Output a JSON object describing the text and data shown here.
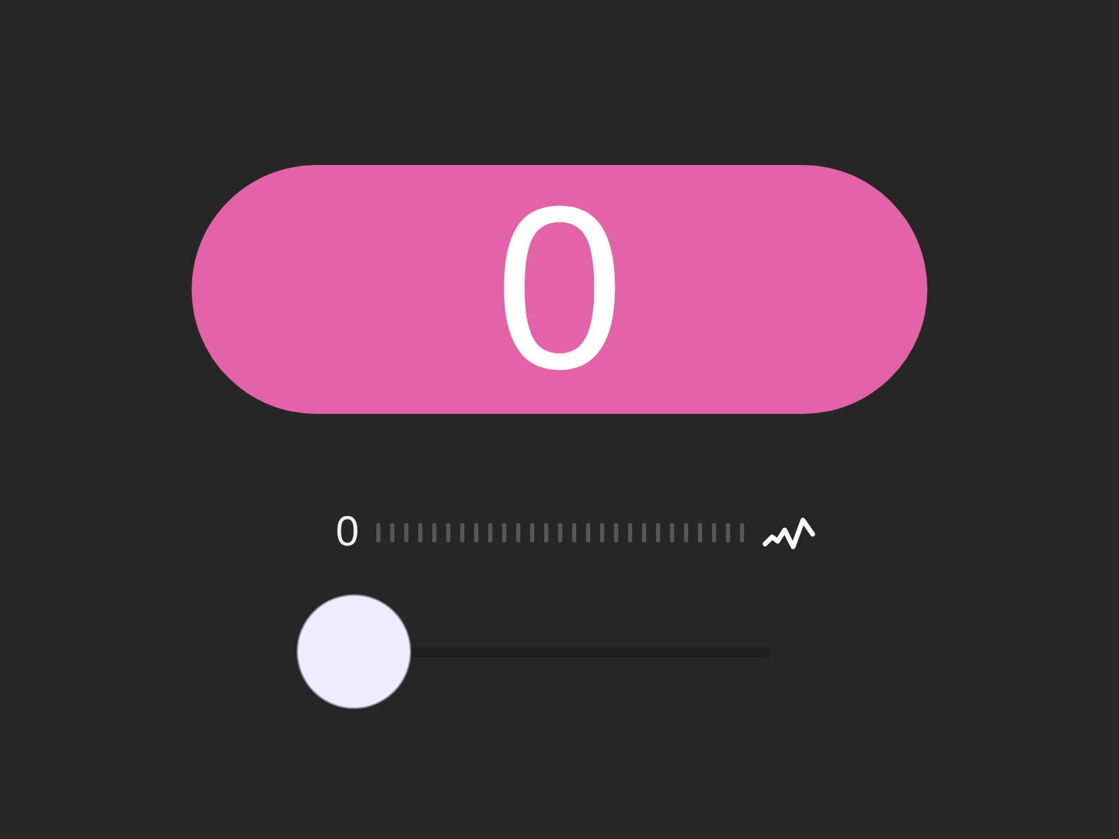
{
  "counter": {
    "value": "0"
  },
  "meter": {
    "reading": "0"
  },
  "slider": {
    "level": 0
  }
}
